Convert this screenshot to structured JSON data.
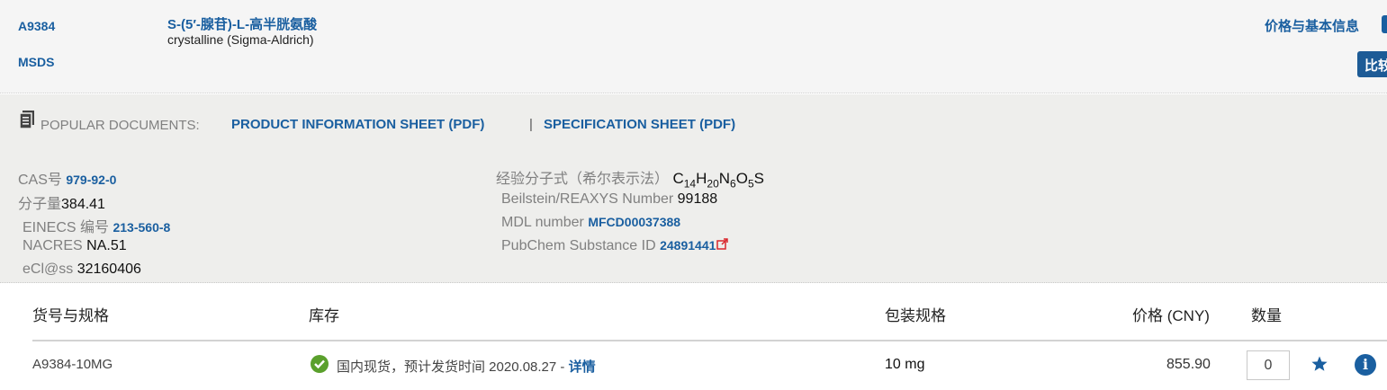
{
  "product": {
    "id": "A9384",
    "msds": "MSDS",
    "name": "S-(5′-腺苷)-L-高半胱氨酸",
    "description": "crystalline (Sigma-Aldrich)",
    "price_info_link": "价格与基本信息",
    "compare_button": "比较"
  },
  "documents": {
    "label": "POPULAR DOCUMENTS:",
    "links": [
      "PRODUCT INFORMATION SHEET (PDF)",
      "SPECIFICATION SHEET (PDF)"
    ],
    "separator": "|"
  },
  "properties_left": [
    {
      "label": "CAS号",
      "value": "979-92-0",
      "is_link": true
    },
    {
      "label": "分子量",
      "value": "384.41",
      "is_link": false
    },
    {
      "label": "EINECS 编号",
      "value": "213-560-8",
      "is_link": true
    },
    {
      "label": "NACRES",
      "value": "NA.51",
      "is_link": false
    },
    {
      "label": "eCl@ss",
      "value": "32160406",
      "is_link": false
    }
  ],
  "properties_right": {
    "formula_label": "经验分子式（希尔表示法）",
    "formula": {
      "C": "14",
      "H": "20",
      "N": "6",
      "O": "5",
      "S": ""
    },
    "beilstein_label": "Beilstein/REAXYS Number",
    "beilstein_value": "99188",
    "mdl_label": "MDL number",
    "mdl_value": "MFCD00037388",
    "pubchem_label": "PubChem Substance ID",
    "pubchem_value": "24891441"
  },
  "table": {
    "headers": {
      "sku": "货号与规格",
      "stock": "库存",
      "pack": "包装规格",
      "price": "价格 (CNY)",
      "qty": "数量"
    },
    "rows": [
      {
        "sku": "A9384-10MG",
        "stock": "国内现货，预计发货时间 2020.08.27 -",
        "details": "详情",
        "pack": "10 mg",
        "price": "855.90",
        "qty": "0"
      }
    ]
  },
  "colors": {
    "link": "#1a5fa0",
    "in_stock": "#5aa02c",
    "header_bg": "#f5f5f5",
    "props_bg": "#eeeeec"
  },
  "icons": {
    "document": "document-icon",
    "external": "external-link-icon",
    "check": "check-circle-icon",
    "star": "star-icon",
    "info": "info-icon"
  }
}
